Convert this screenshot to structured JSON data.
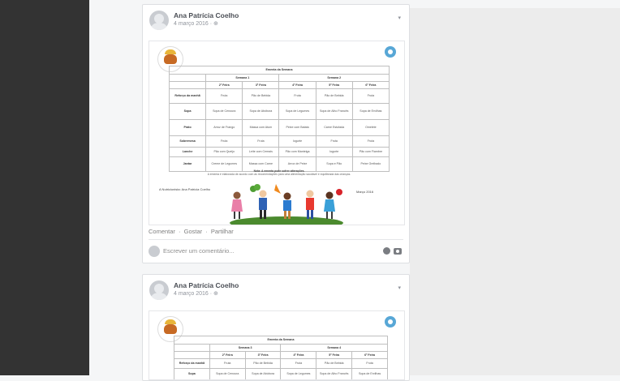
{
  "posts": [
    {
      "author": "Ana Patrícia Coelho",
      "meta": "4 março 2016 · ⊕",
      "actions": {
        "comment": "Comentar",
        "like": "Gostar",
        "share": "Partilhar",
        "sep": "·"
      },
      "comment_placeholder": "Escrever um comentário...",
      "menu": {
        "title": "Ementa da Semana",
        "week_left": "Semana 1",
        "week_right": "Semana 2",
        "days": [
          "2ª Feira",
          "3ª Feira",
          "4ª Feira",
          "5ª Feira",
          "6ª Feira"
        ],
        "rows": [
          {
            "label": "Reforço da manhã",
            "cells": [
              "Fruta",
              "Pão de Bebida",
              "Fruta",
              "Pão de Bebida",
              "Fruta"
            ]
          },
          {
            "label": "Sopa",
            "cells": [
              "Sopa de Cenoura",
              "Sopa de Abóbora",
              "Sopa de Legumes",
              "Sopa de Alho Francês",
              "Sopa de Ervilhas"
            ]
          },
          {
            "label": "Prato",
            "cells": [
              "Arroz de Frango",
              "Massa com Atum",
              "Peixe com Batata",
              "Carne Estufada",
              "Omelete"
            ]
          },
          {
            "label": "Sobremesa",
            "cells": [
              "Fruta",
              "Fruta",
              "Iogurte",
              "Fruta",
              "Fruta"
            ]
          },
          {
            "label": "Lanche",
            "cells": [
              "Pão com Queijo",
              "Leite com Cereais",
              "Pão com Manteiga",
              "Iogurte",
              "Pão com Fiambre"
            ]
          },
          {
            "label": "Jantar",
            "cells": [
              "Creme de Legumes",
              "Massa com Carne",
              "Arroz de Peixe",
              "Sopa e Pão",
              "Peixe Grelhado"
            ]
          }
        ],
        "note_title": "Nota: A ementa pode sofrer alterações.",
        "note_body": "A ementa é elaborada de acordo com as recomendações para uma alimentação saudável e equilibrada das crianças.",
        "signature": "A Nutricionista: Ana Patrícia Coelho",
        "date_right": "Março 2016"
      }
    },
    {
      "author": "Ana Patrícia Coelho",
      "meta": "4 março 2016 · ⊕",
      "menu": {
        "title": "Ementa da Semana",
        "week_left": "Semana 3",
        "week_right": "Semana 4",
        "days": [
          "2ª Feira",
          "3ª Feira",
          "4ª Feira",
          "5ª Feira",
          "6ª Feira"
        ],
        "rows": [
          {
            "label": "Reforço da manhã",
            "cells": [
              "Fruta",
              "Pão de Bebida",
              "Fruta",
              "Pão de Bebida",
              "Fruta"
            ]
          },
          {
            "label": "Sopa",
            "cells": [
              "Sopa de Cenoura",
              "Sopa de Abóbora",
              "Sopa de Legumes",
              "Sopa de Alho Francês",
              "Sopa de Ervilhas"
            ]
          }
        ]
      }
    }
  ]
}
